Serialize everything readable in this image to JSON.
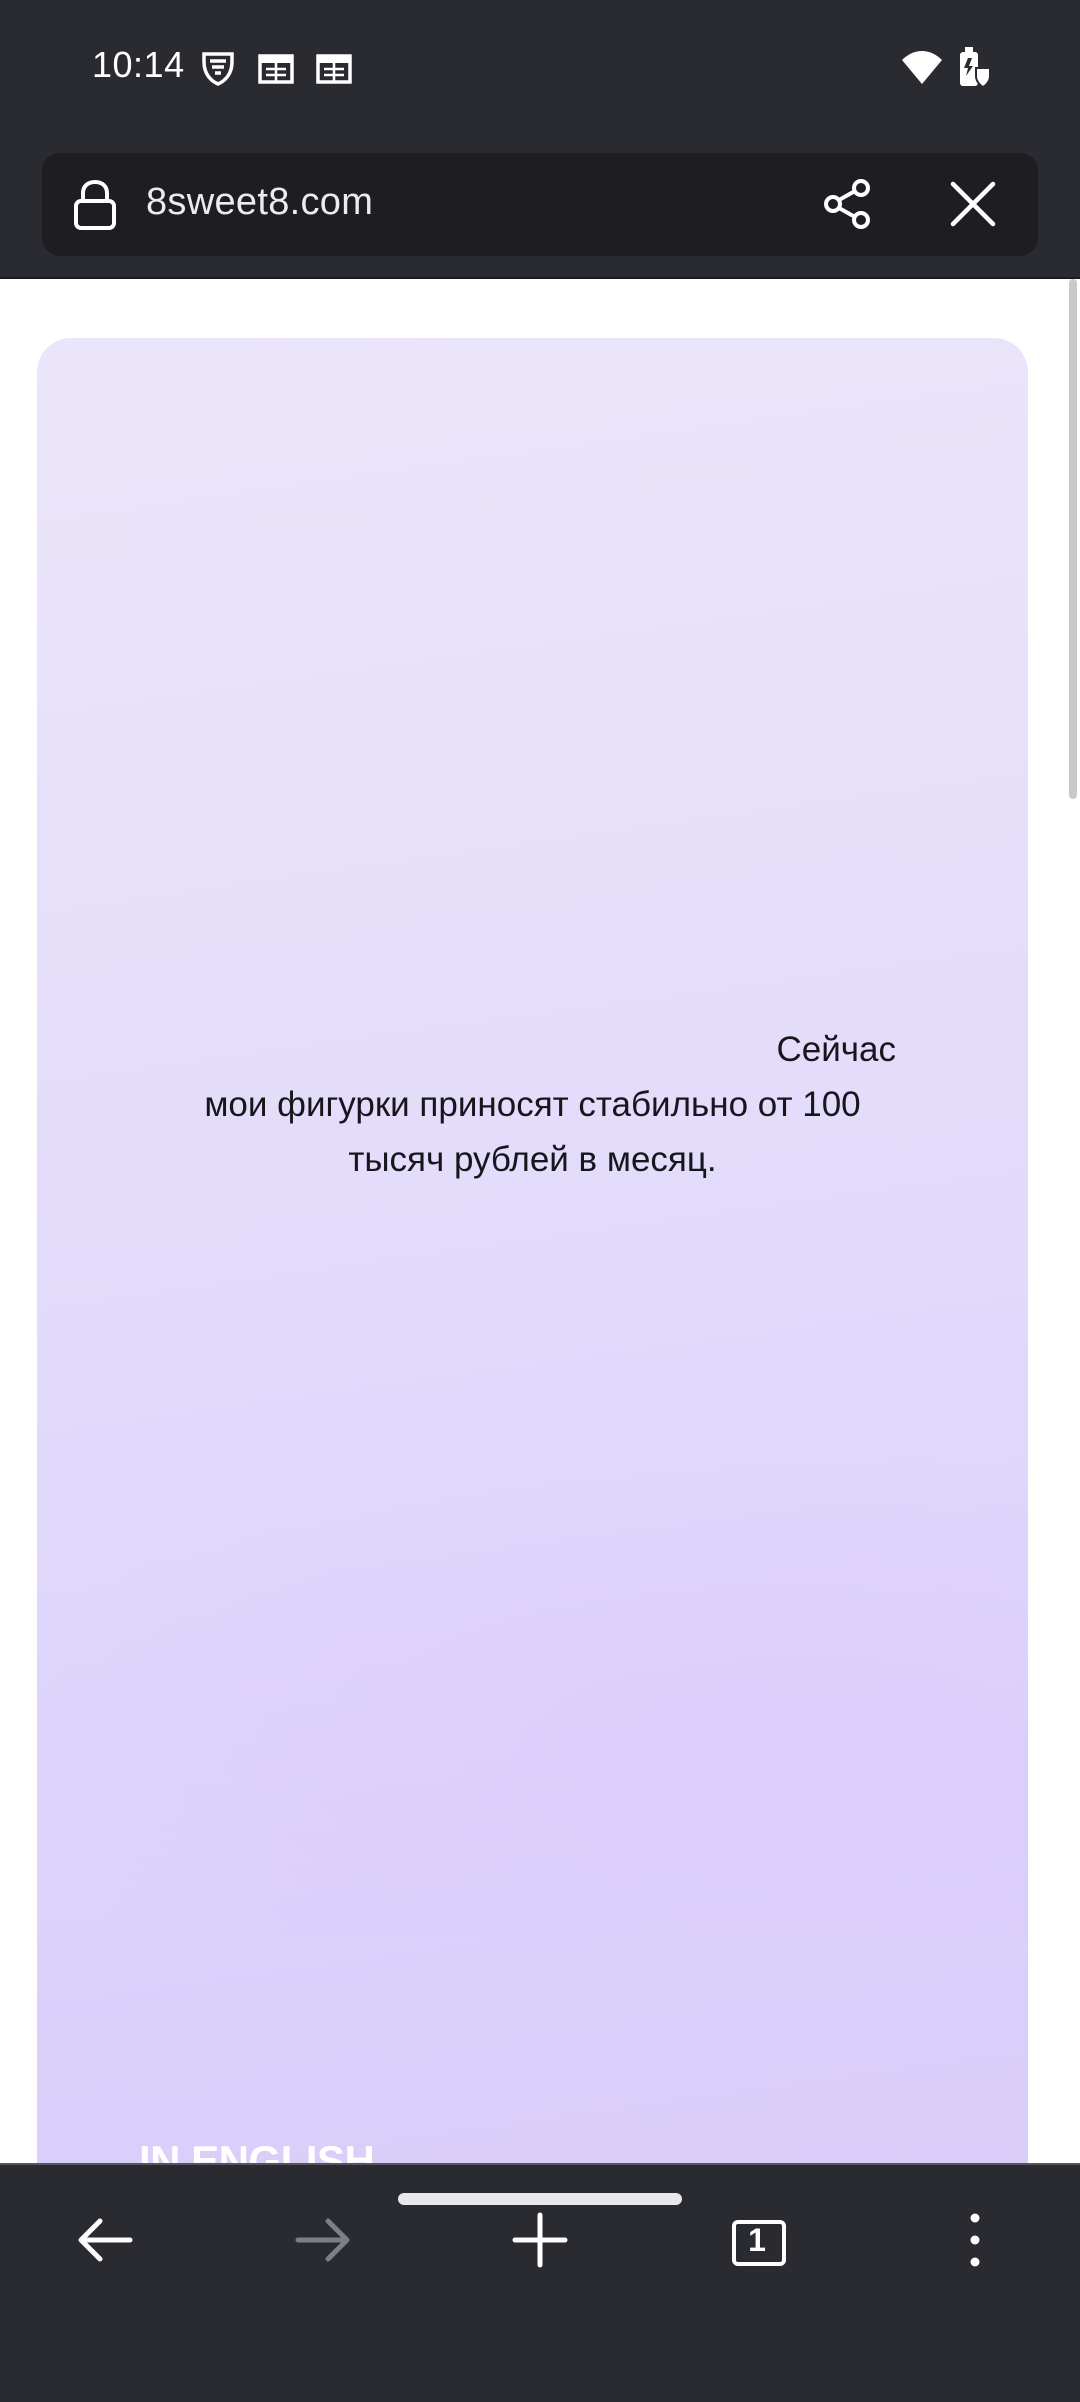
{
  "status_bar": {
    "time": "10:14",
    "icons": [
      "vpn-shield-icon",
      "calendar-icon",
      "calendar-icon",
      "wifi-icon",
      "battery-saver-icon"
    ]
  },
  "browser": {
    "url": "8sweet8.com",
    "tab_count": "1",
    "colors": {
      "chrome": "#2a2a31",
      "url_field": "#1d1d22"
    }
  },
  "page": {
    "card_text": {
      "line1": "Сейчас",
      "line2": "мои фигурки приносят стабильно от 100",
      "line3": "тысяч рублей в месяц."
    },
    "language_link": "IN ENGLISH",
    "colors": {
      "card_top": "#ebe5fb",
      "card_bottom": "#d9ccf8",
      "text": "#16161c"
    }
  }
}
